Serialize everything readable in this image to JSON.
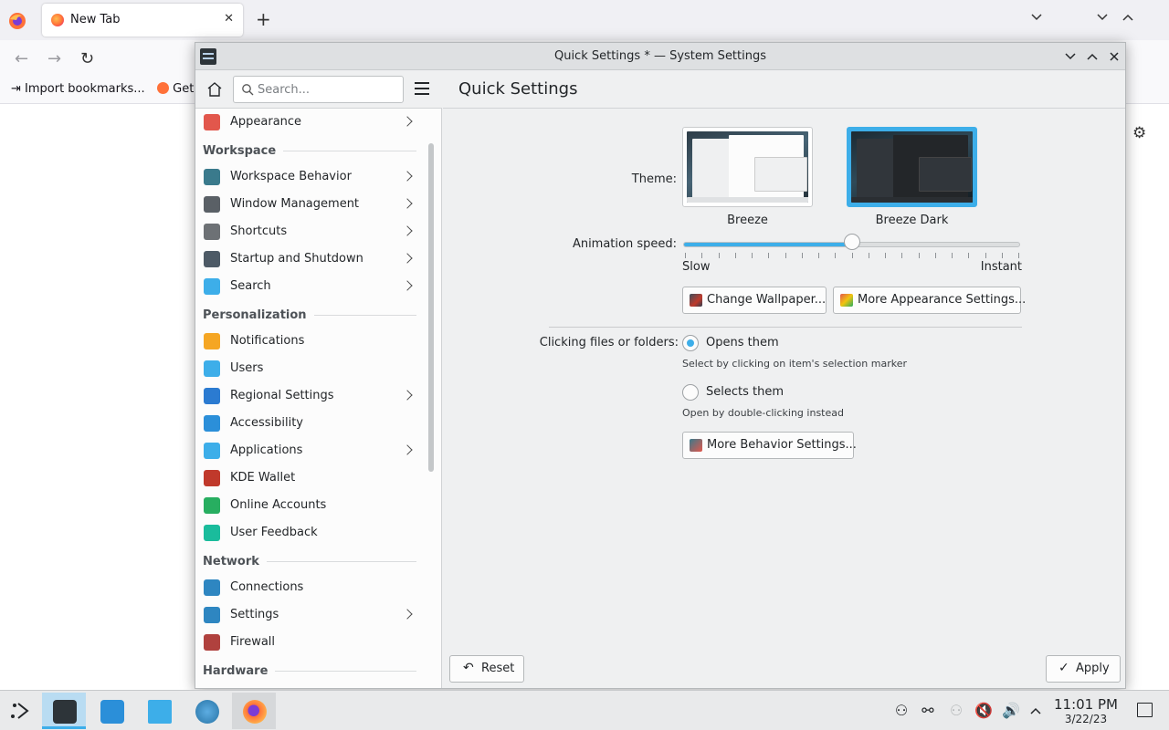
{
  "browser": {
    "tab_title": "New Tab",
    "tab_close": "✕",
    "new_tab": "+",
    "bookmarks": [
      {
        "label": "Import bookmarks..."
      },
      {
        "label": "Get"
      }
    ]
  },
  "window": {
    "title": "Quick Settings * — System Settings"
  },
  "sidebar": {
    "search_placeholder": "Search...",
    "items": [
      {
        "type": "item",
        "label": "Appearance",
        "icon": "appearance-icon",
        "color": "#e2574c",
        "chevron": true
      },
      {
        "type": "section",
        "label": "Workspace"
      },
      {
        "type": "item",
        "label": "Workspace Behavior",
        "icon": "workspace-behavior-icon",
        "color": "#3a7a8c",
        "chevron": true
      },
      {
        "type": "item",
        "label": "Window Management",
        "icon": "window-management-icon",
        "color": "#5a6066",
        "chevron": true
      },
      {
        "type": "item",
        "label": "Shortcuts",
        "icon": "keyboard-icon",
        "color": "#6d7175",
        "chevron": true
      },
      {
        "type": "item",
        "label": "Startup and Shutdown",
        "icon": "startup-shutdown-icon",
        "color": "#4d5a66",
        "chevron": true
      },
      {
        "type": "item",
        "label": "Search",
        "icon": "search-icon",
        "color": "#3daee9",
        "chevron": true
      },
      {
        "type": "section",
        "label": "Personalization"
      },
      {
        "type": "item",
        "label": "Notifications",
        "icon": "bell-icon",
        "color": "#f5a623",
        "chevron": false
      },
      {
        "type": "item",
        "label": "Users",
        "icon": "users-icon",
        "color": "#3daee9",
        "chevron": false
      },
      {
        "type": "item",
        "label": "Regional Settings",
        "icon": "regional-settings-icon",
        "color": "#2b7bd1",
        "chevron": true
      },
      {
        "type": "item",
        "label": "Accessibility",
        "icon": "accessibility-icon",
        "color": "#2b8fd9",
        "chevron": false
      },
      {
        "type": "item",
        "label": "Applications",
        "icon": "applications-icon",
        "color": "#3daee9",
        "chevron": true
      },
      {
        "type": "item",
        "label": "KDE Wallet",
        "icon": "wallet-icon",
        "color": "#c0392b",
        "chevron": false
      },
      {
        "type": "item",
        "label": "Online Accounts",
        "icon": "online-accounts-icon",
        "color": "#27ae60",
        "chevron": false
      },
      {
        "type": "item",
        "label": "User Feedback",
        "icon": "feedback-icon",
        "color": "#1abc9c",
        "chevron": false
      },
      {
        "type": "section",
        "label": "Network"
      },
      {
        "type": "item",
        "label": "Connections",
        "icon": "globe-icon",
        "color": "#2e86c1",
        "chevron": false
      },
      {
        "type": "item",
        "label": "Settings",
        "icon": "globe-settings-icon",
        "color": "#2e86c1",
        "chevron": true
      },
      {
        "type": "item",
        "label": "Firewall",
        "icon": "firewall-icon",
        "color": "#b0413e",
        "chevron": false
      },
      {
        "type": "section",
        "label": "Hardware"
      }
    ]
  },
  "content": {
    "title": "Quick Settings",
    "theme_label": "Theme:",
    "themes": [
      {
        "name": "Breeze",
        "selected": false
      },
      {
        "name": "Breeze Dark",
        "selected": true
      }
    ],
    "animation_label": "Animation speed:",
    "animation_value": 0.5,
    "slider_min": "Slow",
    "slider_max": "Instant",
    "change_wallpaper": "Change Wallpaper...",
    "more_appearance": "More Appearance Settings...",
    "clicking_label": "Clicking files or folders:",
    "opt_open": "Opens them",
    "opt_open_hint": "Select by clicking on item's selection marker",
    "opt_select": "Selects them",
    "opt_select_hint": "Open by double-clicking instead",
    "click_choice": "open",
    "more_behavior": "More Behavior Settings...",
    "reset": "Reset",
    "apply": "Apply"
  },
  "taskbar": {
    "time": "11:01 PM",
    "date": "3/22/23"
  },
  "colors": {
    "accent": "#3daee9"
  }
}
